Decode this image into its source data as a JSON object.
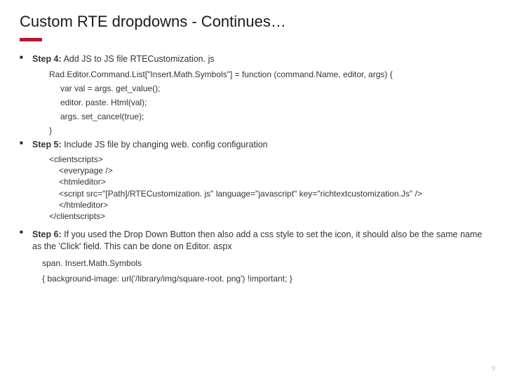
{
  "title": "Custom RTE dropdowns - Continues…",
  "step4": {
    "label": "Step 4:",
    "text": " Add JS  to JS file RTECustomization. js",
    "code": {
      "line1": "Rad.Editor.Command.List[\"Insert.Math.Symbols\"] = function (command.Name, editor, args) {",
      "line2": "var val = args. get_value();",
      "line3": "editor. paste. Html(val);",
      "line4": "args. set_cancel(true);",
      "line5": "}"
    }
  },
  "step5": {
    "label": "Step 5:",
    "text": " Include JS file by changing web. config configuration",
    "config": {
      "l1": "<clientscripts>",
      "l2": "<everypage />",
      "l3": "<htmleditor>",
      "l4": "<script src=\"[Path]/RTECustomization. js\" language=\"javascript\" key=\"richtextcustomization.Js\" />",
      "l5": "</htmleditor>",
      "l6": "</clientscripts>"
    }
  },
  "step6": {
    "label": "Step 6:",
    "text": " If you used the Drop Down Button then also add a css style to set the icon, it should also be the same name as the 'Click' field. This can be done on Editor. aspx",
    "cssSelector": "span. Insert.Math.Symbols",
    "cssRule": "{       background-image: url('/library/img/square-root. png') !important;  }"
  },
  "pageNumber": "9"
}
